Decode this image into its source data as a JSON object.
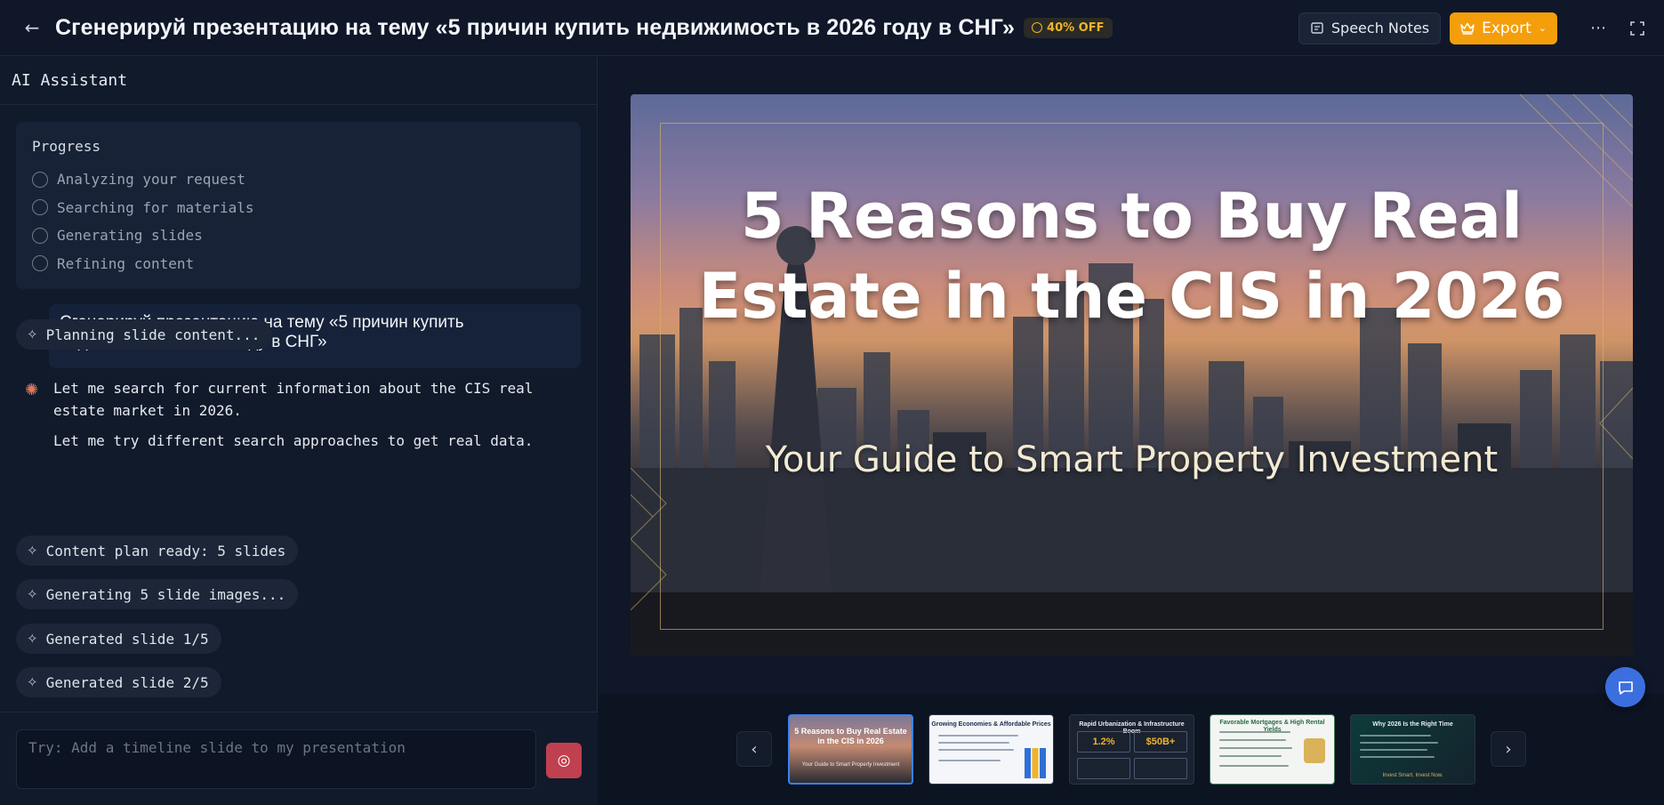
{
  "header": {
    "title": "Сгенерируй презентацию на тему «5 причин купить недвижимость в 2026 году в СНГ»",
    "discount_label": "40% OFF",
    "speech_notes_label": "Speech Notes",
    "export_label": "Export",
    "back_icon": "arrow-left-icon",
    "more_icon": "more-horizontal-icon",
    "fullscreen_icon": "fullscreen-icon"
  },
  "assistant": {
    "panel_title": "AI Assistant",
    "progress": {
      "title": "Progress",
      "steps": [
        {
          "label": "Analyzing your request"
        },
        {
          "label": "Searching for materials"
        },
        {
          "label": "Generating slides"
        },
        {
          "label": "Refining content"
        }
      ]
    },
    "user_message": "Сгенерируй презентацию на тему «5 причин купить недвижимость в 2026 году в СНГ»",
    "status_chips": [
      {
        "label": "Planning slide content..."
      },
      {
        "label": "Content plan ready: 5 slides"
      },
      {
        "label": "Generating 5 slide images..."
      },
      {
        "label": "Generated slide 1/5"
      },
      {
        "label": "Generated slide 2/5"
      }
    ],
    "assistant_messages": [
      "Let me search for current information about the CIS real estate market in 2026.",
      "Let me try different search approaches to get real data."
    ],
    "input_placeholder": "Try: Add a timeline slide to my presentation"
  },
  "slide": {
    "title": "5 Reasons to Buy Real Estate in the CIS in 2026",
    "subtitle": "Your Guide to Smart Property Investment"
  },
  "thumbnails": [
    {
      "title": "5 Reasons to Buy Real Estate in the CIS in 2026",
      "subtitle": "Your Guide to Smart Property Investment"
    },
    {
      "title": "Growing Economies & Affordable Prices"
    },
    {
      "title": "Rapid Urbanization & Infrastructure Boom",
      "stat1": "1.2%",
      "stat2": "$50B+"
    },
    {
      "title": "Favorable Mortgages & High Rental Yields"
    },
    {
      "title": "Why 2026 Is the Right Time",
      "footer": "Invest Smart. Invest Now."
    }
  ],
  "colors": {
    "accent": "#f59e0b",
    "send": "#c0404f",
    "active_thumb": "#3b82f6",
    "gold": "#d6b26a"
  }
}
